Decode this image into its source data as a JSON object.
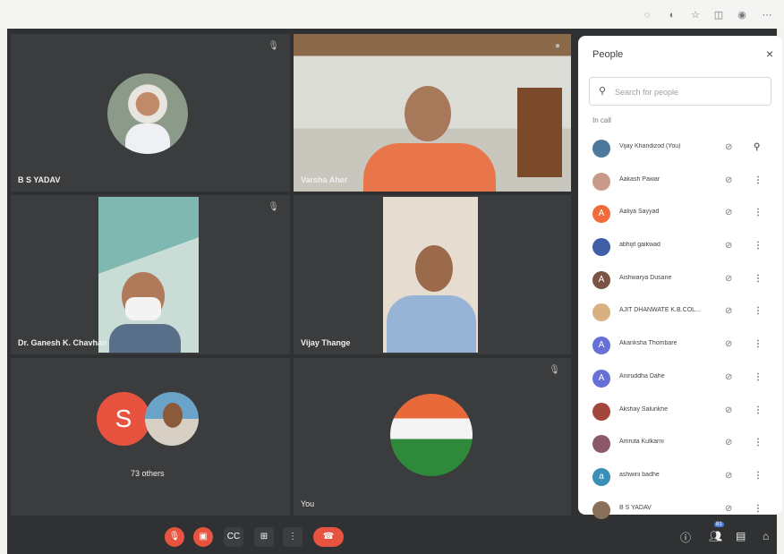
{
  "meeting": {
    "tiles": {
      "bs_yadav": "B S YADAV",
      "varsha": "Varsha Aher",
      "ganesh": "Dr. Ganesh K. Chavhan",
      "vijay": "Vijay Thange",
      "others_count": "73 others",
      "others_initial": "S",
      "you": "You"
    }
  },
  "people_panel": {
    "title": "People",
    "close_icon": "×",
    "search_placeholder": "Search for people",
    "section_label": "In call",
    "participants": [
      {
        "name": "Vijay Khandizod (You)",
        "initial": "",
        "color": "#4d7a9c",
        "action": "pin"
      },
      {
        "name": "Aakash Pawar",
        "initial": "",
        "color": "#c99a8a",
        "action": "more"
      },
      {
        "name": "Aaliya Sayyad",
        "initial": "A",
        "color": "#f26b3a",
        "action": "more"
      },
      {
        "name": "abhijit gaikwad",
        "initial": "",
        "color": "#3f5fa8",
        "action": "more"
      },
      {
        "name": "Aishwarya Dusane",
        "initial": "A",
        "color": "#7a5546",
        "action": "more"
      },
      {
        "name": "AJIT DHANWATE K.B.COL...",
        "initial": "",
        "color": "#d9b080",
        "action": "more"
      },
      {
        "name": "Akanksha Thombare",
        "initial": "A",
        "color": "#6670d6",
        "action": "more"
      },
      {
        "name": "Aniruddha Dahe",
        "initial": "A",
        "color": "#6670d6",
        "action": "more"
      },
      {
        "name": "Akshay Salunkhe",
        "initial": "",
        "color": "#a3463c",
        "action": "more"
      },
      {
        "name": "Amruta Kulkarni",
        "initial": "",
        "color": "#8a5a6a",
        "action": "more"
      },
      {
        "name": "ashwini badhe",
        "initial": "a",
        "color": "#3a8fb5",
        "action": "more"
      },
      {
        "name": "B S YADAV",
        "initial": "",
        "color": "#8a7058",
        "action": "more"
      }
    ]
  },
  "controls": {
    "mic": "mic-off",
    "camera": "camera-off",
    "captions": "CC",
    "present": "present",
    "more": "⋮",
    "end_call": "end-call"
  },
  "right_controls": {
    "people_count": "81"
  },
  "colors": {
    "stage": "#2f3133",
    "red_button": "#e8533f",
    "panel": "#ffffff"
  }
}
